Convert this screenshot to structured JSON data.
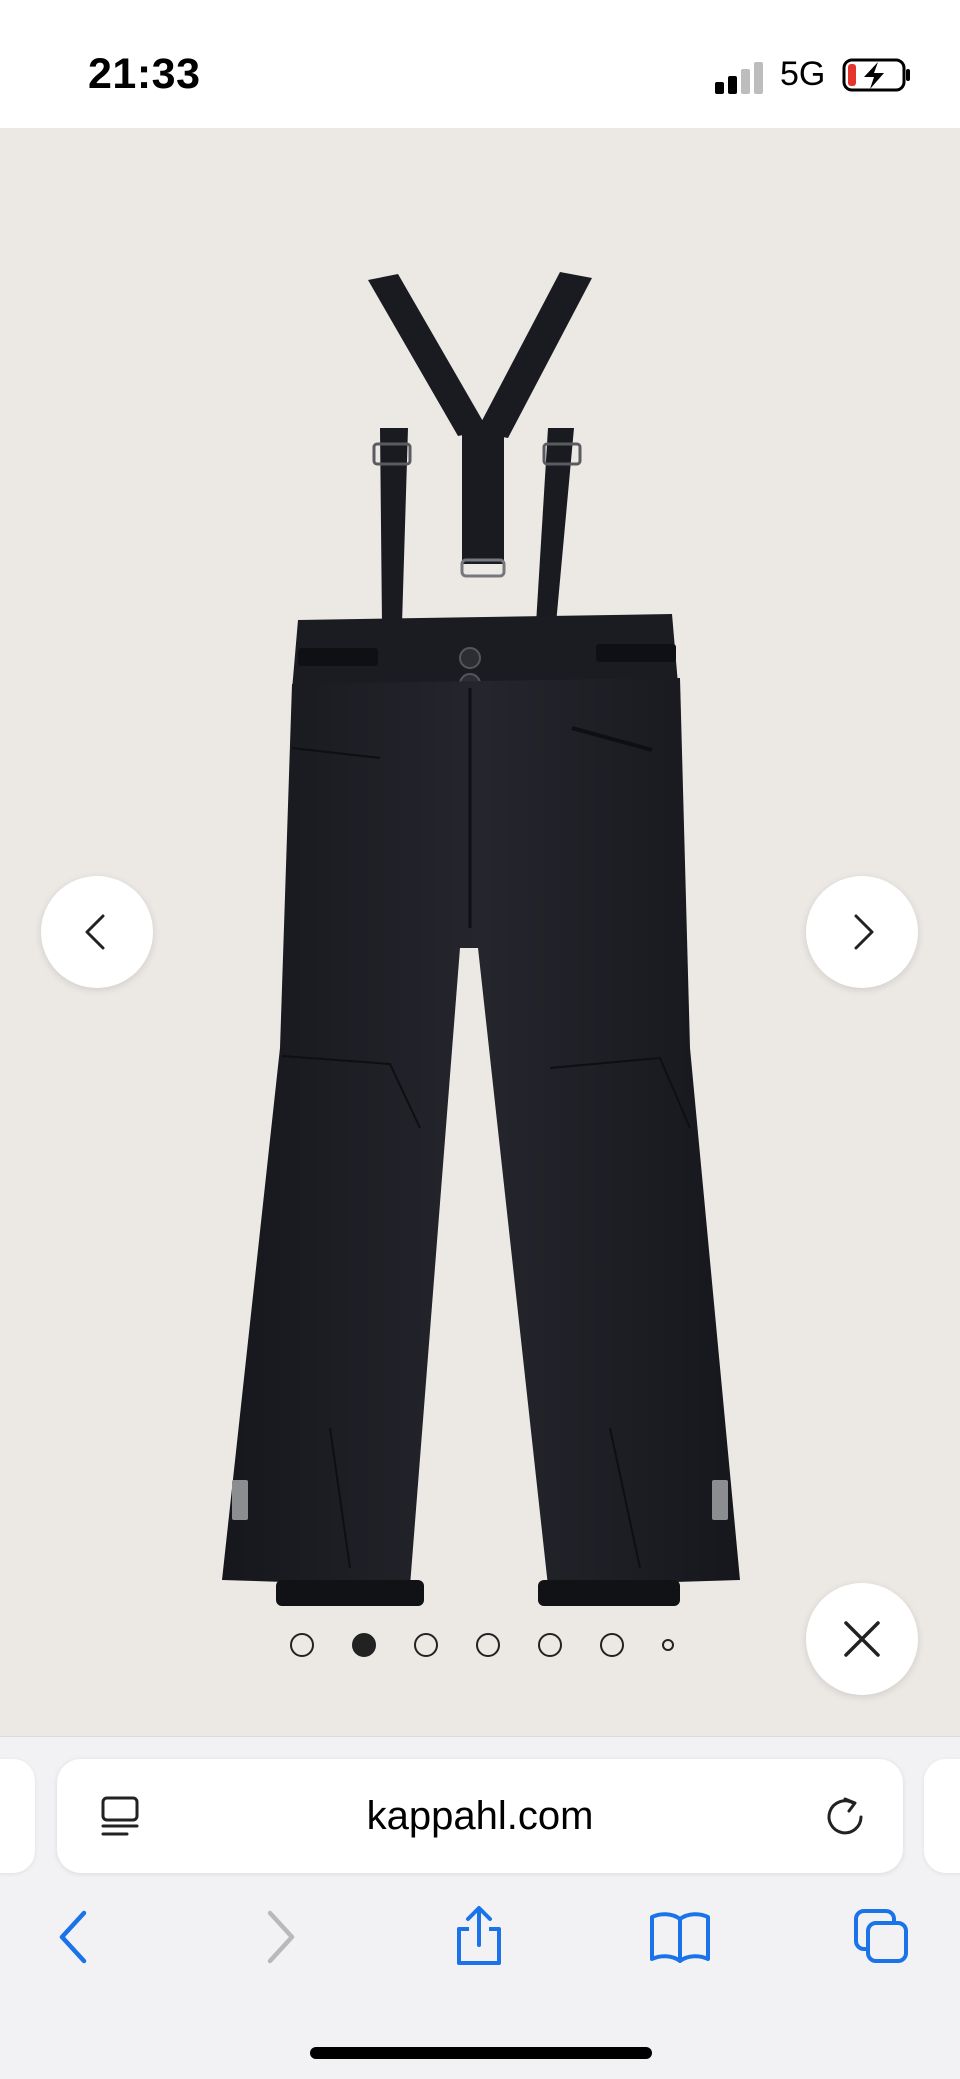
{
  "status_bar": {
    "time": "21:33",
    "network": "5G"
  },
  "gallery": {
    "product": "black kids ski pants with suspenders",
    "total_images": 7,
    "active_index": 1
  },
  "browser": {
    "url": "kappahl.com"
  },
  "icons": {
    "prev": "chevron-left-icon",
    "next": "chevron-right-icon",
    "close": "close-icon",
    "reader": "reader-mode-icon",
    "reload": "reload-icon",
    "back": "back-arrow-icon",
    "forward": "forward-arrow-icon",
    "share": "share-icon",
    "bookmarks": "bookmarks-icon",
    "tabs": "tabs-icon"
  },
  "colors": {
    "accent": "#1a73e8",
    "gallery_bg": "#ece9e5",
    "garment": "#1c1d22",
    "battery_low": "#e5352c"
  }
}
